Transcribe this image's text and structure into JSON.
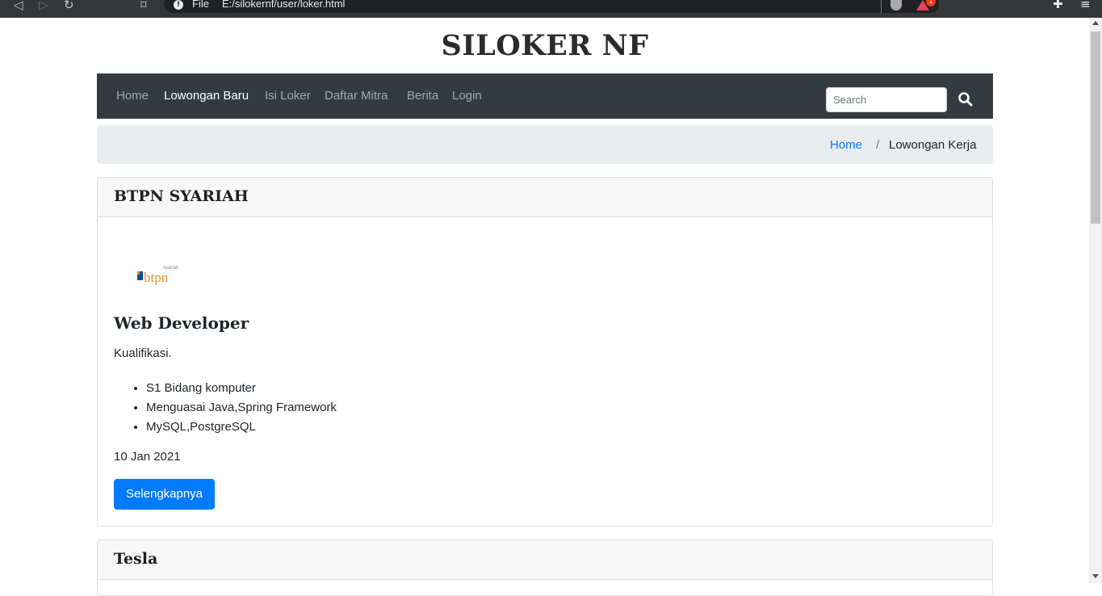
{
  "browser": {
    "file_label": "File",
    "url": "E:/silokernf/user/loker.html",
    "notification_count": "1"
  },
  "site": {
    "title": "SILOKER NF"
  },
  "nav": {
    "items": [
      {
        "label": "Home",
        "active": false
      },
      {
        "label": "Lowongan Baru",
        "active": true
      },
      {
        "label": "Isi Loker",
        "active": false
      },
      {
        "label": "Daftar Mitra",
        "active": false
      },
      {
        "label": "Berita",
        "active": false
      },
      {
        "label": "Login",
        "active": false
      }
    ],
    "search_placeholder": "Search"
  },
  "breadcrumb": {
    "home": "Home",
    "separator": "/",
    "current": "Lowongan Kerja"
  },
  "jobs": [
    {
      "company": "BTPN SYARIAH",
      "logo_text": "btpn",
      "logo_subtext": "syariah",
      "title": "Web Developer",
      "qualification_label": "Kualifikasi.",
      "requirements": [
        "S1 Bidang komputer",
        "Menguasai Java,Spring Framework",
        "MySQL,PostgreSQL"
      ],
      "date": "10 Jan 2021",
      "button_label": "Selengkapnya"
    },
    {
      "company": "Tesla"
    }
  ],
  "colors": {
    "navbar": "#343a40",
    "primary": "#007bff",
    "breadcrumb_bg": "#e9ecef"
  }
}
